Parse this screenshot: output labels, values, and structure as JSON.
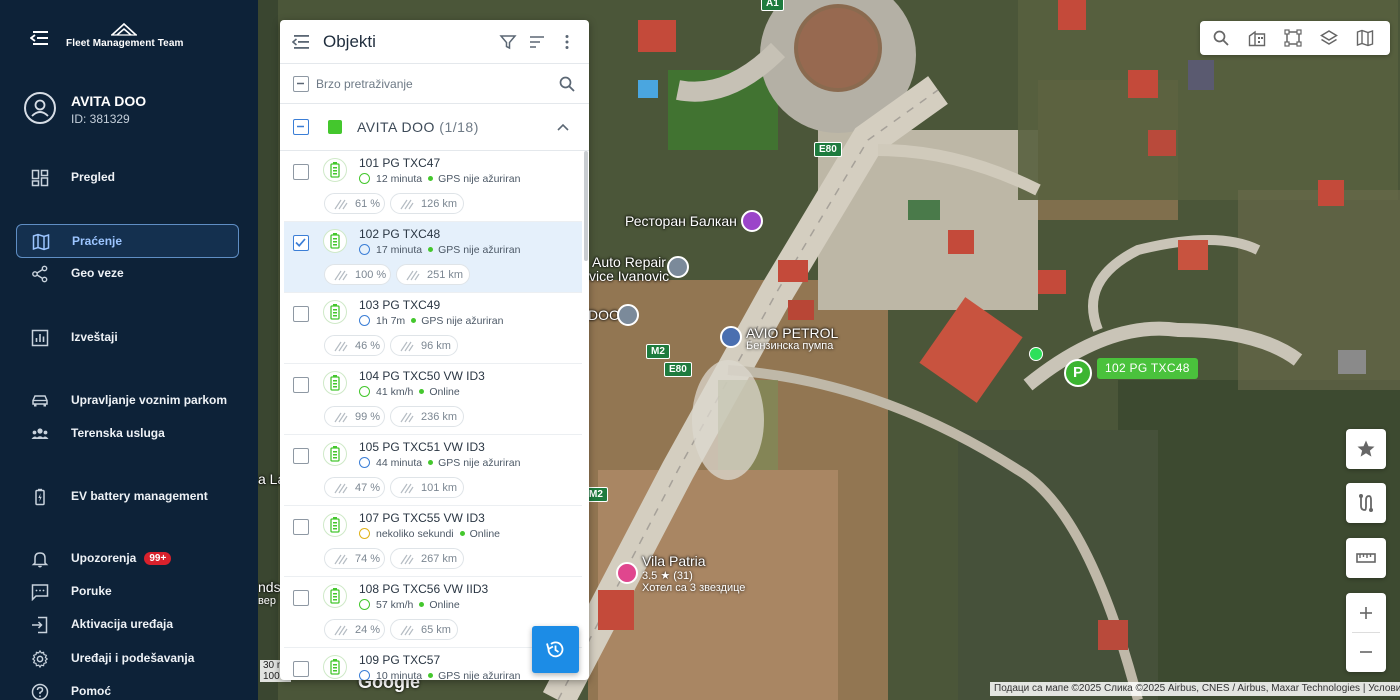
{
  "app": {
    "logo_text": "Fleet Management Team"
  },
  "account": {
    "name": "AVITA DOO",
    "id": "ID: 381329"
  },
  "nav": [
    {
      "key": "pregled",
      "label": "Pregled",
      "icon": "dashboard-icon",
      "active": false
    },
    {
      "key": "pracenje",
      "label": "Praćenje",
      "icon": "map-icon",
      "active": true
    },
    {
      "key": "geo",
      "label": "Geo veze",
      "icon": "share-icon",
      "active": false
    },
    {
      "key": "izvestaji",
      "label": "Izveštaji",
      "icon": "report-icon",
      "active": false
    },
    {
      "key": "upravljanje",
      "label": "Upravljanje voznim parkom",
      "icon": "car-icon",
      "active": false
    },
    {
      "key": "terenska",
      "label": "Terenska usluga",
      "icon": "group-icon",
      "active": false
    },
    {
      "key": "ev",
      "label": "EV battery management",
      "icon": "battery-icon",
      "active": false
    },
    {
      "key": "upozorenja",
      "label": "Upozorenja",
      "icon": "bell-icon",
      "badge": "99+",
      "active": false
    },
    {
      "key": "poruke",
      "label": "Poruke",
      "icon": "message-icon",
      "active": false
    },
    {
      "key": "aktivacija",
      "label": "Aktivacija uređaja",
      "icon": "login-icon",
      "active": false
    },
    {
      "key": "uredjaji",
      "label": "Uređaji i podešavanja",
      "icon": "gear-icon",
      "active": false
    },
    {
      "key": "pomoc",
      "label": "Pomoć",
      "icon": "help-icon",
      "active": false
    }
  ],
  "panel": {
    "title": "Objekti",
    "search_placeholder": "Brzo pretraživanje",
    "group": {
      "name": "AVITA DOO",
      "count": "(1/18)",
      "color": "#44c72d"
    },
    "vehicles": [
      {
        "name": "101 PG TXC47",
        "status_icon": "parked",
        "status": "12  minuta",
        "gps": "GPS nije ažuriran",
        "battery": "61 %",
        "range": "126 km",
        "checked": false
      },
      {
        "name": "102 PG TXC48",
        "status_icon": "parked",
        "status": "17  minuta",
        "gps": "GPS nije ažuriran",
        "battery": "100 %",
        "range": "251 km",
        "checked": true
      },
      {
        "name": "103 PG TXC49",
        "status_icon": "parked",
        "status": "1h 7m",
        "gps": "GPS nije ažuriran",
        "battery": "46 %",
        "range": "96 km",
        "checked": false
      },
      {
        "name": "104 PG TXC50 VW ID3",
        "status_icon": "moving",
        "status": "41 km/h",
        "gps": "Online",
        "battery": "99 %",
        "range": "236 km",
        "checked": false
      },
      {
        "name": "105 PG TXC51 VW ID3",
        "status_icon": "parked",
        "status": "44  minuta",
        "gps": "GPS nije ažuriran",
        "battery": "47 %",
        "range": "101 km",
        "checked": false
      },
      {
        "name": "107 PG TXC55 VW ID3",
        "status_icon": "idle",
        "status": "nekoliko sekundi",
        "gps": "Online",
        "battery": "74 %",
        "range": "267 km",
        "checked": false
      },
      {
        "name": "108 PG TXC56 VW IID3",
        "status_icon": "moving",
        "status": "57 km/h",
        "gps": "Online",
        "battery": "24 %",
        "range": "65 km",
        "checked": false
      },
      {
        "name": "109 PG TXC57",
        "status_icon": "parked",
        "status": "10  minuta",
        "gps": "GPS nije ažuriran",
        "battery": "",
        "range": "",
        "checked": false
      }
    ]
  },
  "map": {
    "vehicle_label": "102 PG TXC48",
    "vehicle_marker": "P",
    "places": {
      "restoran": "Ресторан Балкан",
      "auto_repair": "Auto Repair",
      "auto_repair_2": "vice Ivanovic",
      "doo": "DOO",
      "avio": "AVIO PETROL",
      "avio_sub": "Бензинска пумпа",
      "vila": "Vila Patria",
      "vila_rating": "3.5 ★ (31)",
      "vila_sub": "Хотел са 3 звездице",
      "left_edge_1": "a La",
      "left_edge_2": "nds",
      "left_edge_3": "вер"
    },
    "roads": {
      "a1": "A1",
      "e80_a": "E80",
      "e80_b": "E80",
      "m2_a": "M2",
      "m2_b": "M2"
    },
    "scale_1": "30 m",
    "scale_2": "100 ft",
    "google": "Google",
    "attribution": "Подаци са мапе ©2025 Слика ©2025 Airbus, CNES / Airbus, Maxar Technologies  |  Услови"
  }
}
